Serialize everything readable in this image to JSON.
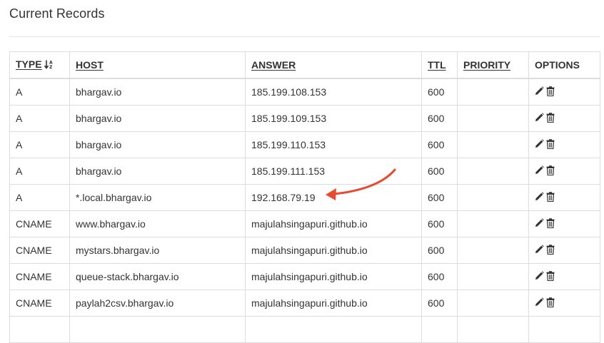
{
  "heading": "Current Records",
  "columns": {
    "type": "TYPE",
    "host": "HOST",
    "answer": "ANSWER",
    "ttl": "TTL",
    "priority": "PRIORITY",
    "options": "OPTIONS"
  },
  "icons": {
    "sort": "sort-alpha-down-icon",
    "edit": "pencil-icon",
    "delete": "trash-icon"
  },
  "annotation": {
    "arrow_color": "#e8492f"
  },
  "rows": [
    {
      "type": "A",
      "host": "bhargav.io",
      "answer": "185.199.108.153",
      "ttl": "600",
      "priority": ""
    },
    {
      "type": "A",
      "host": "bhargav.io",
      "answer": "185.199.109.153",
      "ttl": "600",
      "priority": ""
    },
    {
      "type": "A",
      "host": "bhargav.io",
      "answer": "185.199.110.153",
      "ttl": "600",
      "priority": ""
    },
    {
      "type": "A",
      "host": "bhargav.io",
      "answer": "185.199.111.153",
      "ttl": "600",
      "priority": ""
    },
    {
      "type": "A",
      "host": "*.local.bhargav.io",
      "answer": "192.168.79.19",
      "ttl": "600",
      "priority": ""
    },
    {
      "type": "CNAME",
      "host": "www.bhargav.io",
      "answer": "majulahsingapuri.github.io",
      "ttl": "600",
      "priority": ""
    },
    {
      "type": "CNAME",
      "host": "mystars.bhargav.io",
      "answer": "majulahsingapuri.github.io",
      "ttl": "600",
      "priority": ""
    },
    {
      "type": "CNAME",
      "host": "queue-stack.bhargav.io",
      "answer": "majulahsingapuri.github.io",
      "ttl": "600",
      "priority": ""
    },
    {
      "type": "CNAME",
      "host": "paylah2csv.bhargav.io",
      "answer": "majulahsingapuri.github.io",
      "ttl": "600",
      "priority": ""
    },
    {
      "type": "",
      "host": "",
      "answer": "",
      "ttl": "",
      "priority": ""
    }
  ]
}
